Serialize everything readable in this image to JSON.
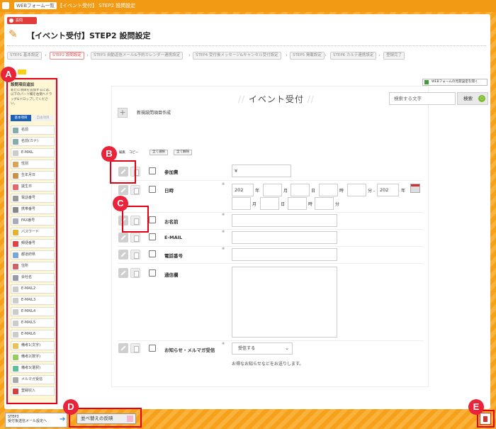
{
  "topbar": {
    "box_label": "WEBフォーム一覧",
    "crumb": "› 【イベント受付】 STEP2 設問設定"
  },
  "app_label": "設問",
  "page_title": "【イベント受付】STEP2 設問設定",
  "steps": [
    "STEP1 基本設定",
    "STEP2 設問設定",
    "STEP3 自動返信メール&予約カレンダー連携設定",
    "STEP4 受付後メッセージ&キャンセル受付設定",
    "STEP5 掲載設定",
    "STEP6 カルテ連携設定",
    "登録完了"
  ],
  "sidebar": {
    "heading": "設問項目追加",
    "description": "新たに項目を追加するには、以下のパーツ欄を右側へドラッグ&ドロップしてください。",
    "tab_basic": "基本項目",
    "tab_custom": "自由項目",
    "items": [
      "名前",
      "名前(カナ)",
      "E-MAIL",
      "性別",
      "生年月日",
      "誕生日",
      "電話番号",
      "携帯番号",
      "FAX番号",
      "パスワード",
      "郵便番号",
      "都道府県",
      "住所",
      "会社名",
      "E-MAIL2",
      "E-MAIL3",
      "E-MAIL4",
      "E-MAIL5",
      "E-MAIL6",
      "備考1(文字)",
      "備考2(数字)",
      "備考3(選択)",
      "メルマガ受信",
      "登録収入"
    ]
  },
  "web_button": "WEBフォームの見開設定を開く",
  "form": {
    "title": "イベント受付",
    "search_placeholder": "検索する文字",
    "search_button": "検索",
    "new_item": "新規設問項目作成",
    "col_edit": "編集",
    "col_copy": "コピー",
    "select_all": "全て選択",
    "deselect_all": "全て解除",
    "rows": [
      {
        "label": "参加費",
        "value": "¥"
      },
      {
        "label": "日時",
        "year_value": "202",
        "year_value2": "202"
      },
      {
        "label": "お名前"
      },
      {
        "label": "E-MAIL"
      },
      {
        "label": "電話番号"
      },
      {
        "label": "通信欄"
      },
      {
        "label": "お知らせ・メルマガ受信",
        "select_value": "受信する",
        "hint": "お得なお知らせなどをお送りします。"
      }
    ],
    "units": {
      "year": "年",
      "month": "月",
      "day": "日",
      "hour": "時",
      "minute": "分",
      "dash": "分 -"
    },
    "required_mark": "※"
  },
  "bottom": {
    "step_button_line1": "STEP3",
    "step_button_line2": "受付後送信メール設定へ",
    "sort_button": "並べ替えの反映"
  },
  "annotations": [
    "A",
    "B",
    "C",
    "D",
    "E"
  ],
  "colors": {
    "accent": "#f39a14",
    "annotation": "#e8233a",
    "tab_active": "#1a62b9"
  }
}
